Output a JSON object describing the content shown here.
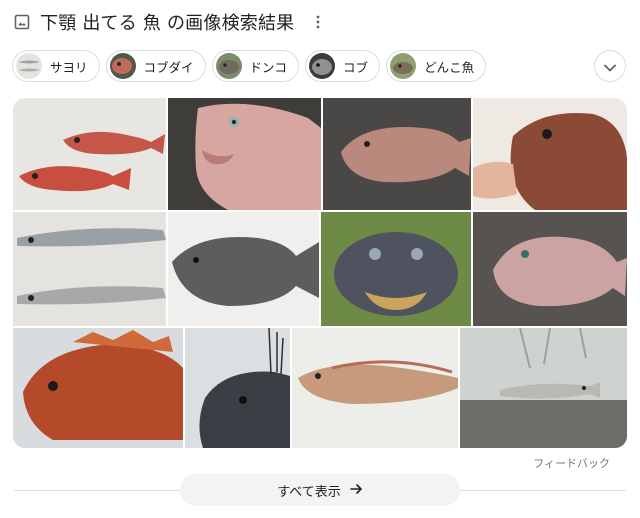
{
  "header": {
    "title": "下顎 出てる 魚 の画像検索結果"
  },
  "chips": [
    {
      "label": "サヨリ",
      "thumb": "sayori"
    },
    {
      "label": "コブダイ",
      "thumb": "kobudai"
    },
    {
      "label": "ドンコ",
      "thumb": "donko"
    },
    {
      "label": "コブ",
      "thumb": "kobu"
    },
    {
      "label": "どんこ魚",
      "thumb": "donko-fish"
    }
  ],
  "images": [
    "red-rockfish-pair",
    "kobudai-pink-head",
    "kobudai-on-gravel",
    "scorpionfish-hand",
    "sayori-pair",
    "grey-grouper",
    "stonefish-face",
    "kobudai-on-sand",
    "red-scorpionfish",
    "black-fish-head",
    "spotted-eelpout",
    "small-fish-in-tank"
  ],
  "feedback": "フィードバック",
  "show_all": "すべて表示",
  "colors": {
    "chip_border": "#dadce0",
    "button_bg": "#f1f3f4",
    "text": "#202124",
    "secondary_text": "#70757a"
  }
}
